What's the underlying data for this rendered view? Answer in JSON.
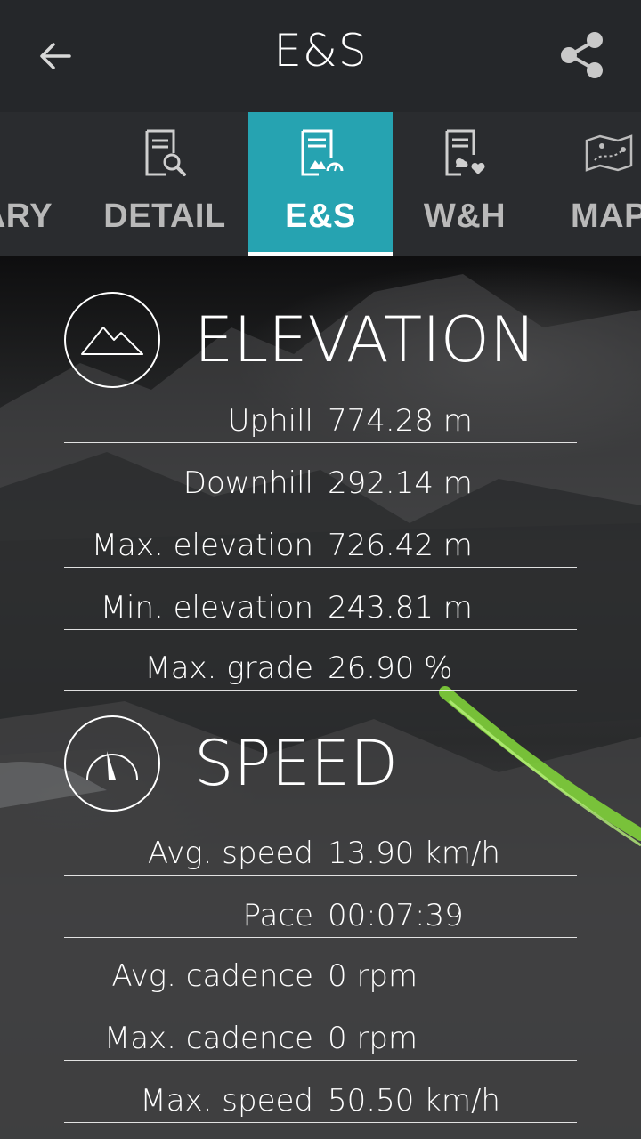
{
  "appbar": {
    "title": "E&S",
    "back_icon": "arrow-left-icon",
    "share_icon": "share-icon"
  },
  "tabs": [
    {
      "label": "ARY",
      "icon": "summary-icon",
      "active": false
    },
    {
      "label": "DETAIL",
      "icon": "document-search-icon",
      "active": false
    },
    {
      "label": "E&S",
      "icon": "document-elevation-speed-icon",
      "active": true
    },
    {
      "label": "W&H",
      "icon": "document-weather-heart-icon",
      "active": false
    },
    {
      "label": "MAP",
      "icon": "map-icon",
      "active": false
    }
  ],
  "colors": {
    "accent": "#26a3b1",
    "appbar": "#25272a",
    "tabbar": "#2a2c2f",
    "route_line": "#7fd03a"
  },
  "elevation": {
    "title": "ELEVATION",
    "icon": "mountain-icon",
    "rows": [
      {
        "label": "Uphill",
        "value": "774.28 m"
      },
      {
        "label": "Downhill",
        "value": "292.14 m"
      },
      {
        "label": "Max. elevation",
        "value": "726.42 m"
      },
      {
        "label": "Min. elevation",
        "value": "243.81 m"
      },
      {
        "label": "Max. grade",
        "value": "26.90 %"
      }
    ]
  },
  "speed": {
    "title": "SPEED",
    "icon": "speedometer-icon",
    "rows": [
      {
        "label": "Avg. speed",
        "value": "13.90 km/h"
      },
      {
        "label": "Pace",
        "value": "00:07:39"
      },
      {
        "label": "Avg. cadence",
        "value": "0 rpm"
      },
      {
        "label": "Max. cadence",
        "value": "0 rpm"
      },
      {
        "label": "Max. speed",
        "value": "50.50 km/h"
      }
    ]
  }
}
